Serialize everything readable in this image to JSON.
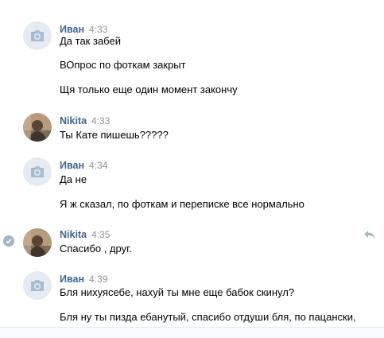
{
  "messages": [
    {
      "author": "Иван",
      "time": "4:33",
      "avatar": "camera-placeholder",
      "lines": [
        "Да так забей",
        "ВОпрос по фоткам закрыт",
        "Щя только еще один момент закончу"
      ]
    },
    {
      "author": "Nikita",
      "time": "4:33",
      "avatar": "user-photo",
      "lines": [
        "Ты Кате пишешь?????"
      ]
    },
    {
      "author": "Иван",
      "time": "4:34",
      "avatar": "camera-placeholder",
      "lines": [
        "Да не",
        "Я ж сказал, по фоткам и переписке все нормально"
      ]
    },
    {
      "author": "Nikita",
      "time": "4:35",
      "avatar": "user-photo",
      "selected": true,
      "lines": [
        "Спасибо , друг."
      ]
    },
    {
      "author": "Иван",
      "time": "4:39",
      "avatar": "camera-placeholder",
      "lines": [
        "Бля нихуясебе, нахуй ты мне еще бабок скинул?",
        "Бля ну ты пизда ебанутый, спасибо отдуши бля, по пацански,"
      ]
    }
  ],
  "colors": {
    "author": "#42648b",
    "time": "#939393",
    "avatar_placeholder": "#e5ebf1",
    "camera_icon": "#a8bcd1",
    "check": "#a3b3c6",
    "reply_icon": "#a8b7c7"
  }
}
